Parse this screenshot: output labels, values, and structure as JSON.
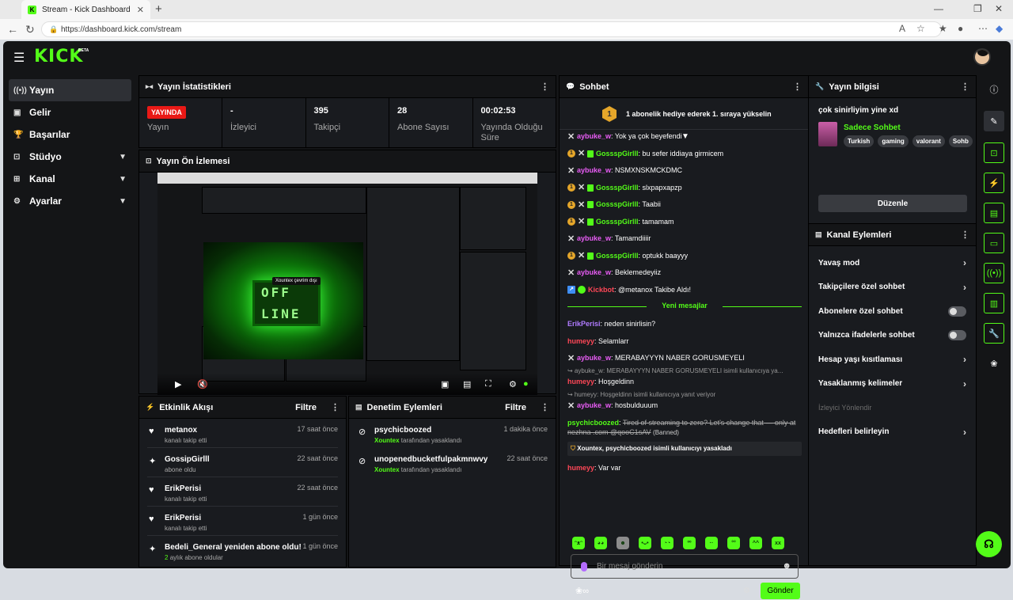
{
  "browser": {
    "tab_title": "Stream - Kick Dashboard",
    "url": "https://dashboard.kick.com/stream"
  },
  "app": {
    "logo": "KICK",
    "beta": "BETA"
  },
  "sidebar": {
    "items": [
      {
        "label": "Yayın",
        "icon": "broadcast-icon",
        "active": true,
        "chevron": false
      },
      {
        "label": "Gelir",
        "icon": "dollar-icon",
        "active": false,
        "chevron": false
      },
      {
        "label": "Başarılar",
        "icon": "trophy-icon",
        "active": false,
        "chevron": false
      },
      {
        "label": "Stüdyo",
        "icon": "studio-icon",
        "active": false,
        "chevron": true
      },
      {
        "label": "Kanal",
        "icon": "channel-icon",
        "active": false,
        "chevron": true
      },
      {
        "label": "Ayarlar",
        "icon": "gear-icon",
        "active": false,
        "chevron": true
      }
    ]
  },
  "stats": {
    "title": "Yayın İstatistikleri",
    "items": [
      {
        "value": "YAYINDA",
        "label": "Yayın"
      },
      {
        "value": "-",
        "label": "İzleyici"
      },
      {
        "value": "395",
        "label": "Takipçi"
      },
      {
        "value": "28",
        "label": "Abone Sayısı"
      },
      {
        "value": "00:02:53",
        "label": "Yayında Olduğu Süre"
      }
    ]
  },
  "preview": {
    "title": "Yayın Ön İzlemesi",
    "offline_top": "OFF",
    "offline_bottom": "LINE",
    "offline_label": "Xountex çevrim dışı"
  },
  "activity": {
    "title": "Etkinlik Akışı",
    "filter": "Filtre",
    "rows": [
      {
        "icon": "heart-icon",
        "name": "metanox",
        "sub": "kanalı takip etti",
        "time": "17 saat önce"
      },
      {
        "icon": "sparkle-icon",
        "name": "GossipGirlll",
        "sub": "abone oldu",
        "time": "22 saat önce"
      },
      {
        "icon": "heart-icon",
        "name": "ErikPerisi",
        "sub": "kanalı takip etti",
        "time": "22 saat önce"
      },
      {
        "icon": "heart-icon",
        "name": "ErikPerisi",
        "sub": "kanalı takip etti",
        "time": "1 gün önce"
      },
      {
        "icon": "sparkle-icon",
        "name": "Bedeli_General yeniden abone oldu!",
        "sub_green": "2",
        "sub": "aylık abone oldular",
        "time": "1 gün önce"
      }
    ]
  },
  "moderation": {
    "title": "Denetim Eylemleri",
    "filter": "Filtre",
    "rows": [
      {
        "name": "psychicboozed",
        "mod": "Xountex",
        "action": "tarafından yasaklandı",
        "time": "1 dakika önce"
      },
      {
        "name": "unopenedbucketfulpakmnwvy",
        "mod": "Xountex",
        "action": "tarafından yasaklandı",
        "time": "22 saat önce"
      }
    ]
  },
  "chat": {
    "title": "Sohbet",
    "pinned_badge": "1",
    "pinned": "1 abonelik hediye ederek 1. sıraya yükselin",
    "new_messages": "Yeni mesajlar",
    "messages_before": [
      {
        "badges": [
          "x"
        ],
        "user": "aybuke_w",
        "color": "pk",
        "text": "Yok ya çok beyefendi"
      },
      {
        "badges": [
          "sub",
          "x",
          "gr"
        ],
        "user": "GossspGirlll",
        "color": "gn",
        "text": "bu sefer iddiaya girmicem"
      },
      {
        "badges": [
          "x"
        ],
        "user": "aybuke_w",
        "color": "pk",
        "text": "NSMXNSKMCKDMC"
      },
      {
        "badges": [
          "sub",
          "x",
          "gr"
        ],
        "user": "GossspGirlll",
        "color": "gn",
        "text": "slxpapxapzp"
      },
      {
        "badges": [
          "sub",
          "x",
          "gr"
        ],
        "user": "GossspGirlll",
        "color": "gn",
        "text": "Taabii"
      },
      {
        "badges": [
          "sub",
          "x",
          "gr"
        ],
        "user": "GossspGirlll",
        "color": "gn",
        "text": "tamamam"
      },
      {
        "badges": [
          "x"
        ],
        "user": "aybuke_w",
        "color": "pk",
        "text": "Tamamdiiiir"
      },
      {
        "badges": [
          "sub",
          "x",
          "gr"
        ],
        "user": "GossspGirlll",
        "color": "gn",
        "text": "optukk baayyy"
      },
      {
        "badges": [
          "x"
        ],
        "user": "aybuke_w",
        "color": "pk",
        "text": "Beklemedeyiiz"
      },
      {
        "badges": [
          "kick",
          "flower"
        ],
        "user": "Kickbot",
        "color": "rd",
        "text": "@metanox Takibe Aldı!"
      }
    ],
    "msg_erik": {
      "user": "ErikPerisi",
      "text": "neden sinirlisin?"
    },
    "msg_h1": {
      "user": "humeyy",
      "text": "Selamlarr"
    },
    "msg_a1": {
      "user": "aybuke_w",
      "text": "MERABAYYYN NABER GORUSMEYELI"
    },
    "reply1": "↪ aybuke_w: MERABAYYYN NABER GORUSMEYELI isimli kullanıcıya ya...",
    "msg_h2": {
      "user": "humeyy",
      "text": "Hoşgeldinn"
    },
    "reply2": "↪ humeyy: Hoşgeldinn isimli kullanıcıya yanıt veriyor",
    "msg_a2": {
      "user": "aybuke_w",
      "text": "hosbulduuum"
    },
    "banned_user": "psychicboozed",
    "banned_text": "Tired of streaming to zero? Let's change that — only at nezhna .com @qooC1sAV",
    "banned_tag": "(Banned)",
    "mod_notice": "Xountex, psychicboozed isimli kullanıcıyı yasakladı",
    "msg_h3": {
      "user": "humeyy",
      "text": "Var var"
    },
    "input_placeholder": "Bir mesaj gönderin",
    "send": "Gönder"
  },
  "info": {
    "title": "Yayın bilgisi",
    "stream_title": "çok sinirliyim yine xd",
    "category": "Sadece Sohbet",
    "tags": [
      "Turkish",
      "gaming",
      "valorant",
      "Sohb"
    ],
    "edit": "Düzenle"
  },
  "actions": {
    "title": "Kanal Eylemleri",
    "items": [
      {
        "label": "Yavaş mod",
        "kind": "chevron"
      },
      {
        "label": "Takipçilere özel sohbet",
        "kind": "chevron"
      },
      {
        "label": "Abonelere özel sohbet",
        "kind": "toggle"
      },
      {
        "label": "Yalnızca ifadelerle sohbet",
        "kind": "toggle"
      },
      {
        "label": "Hesap yaşı kısıtlaması",
        "kind": "chevron"
      },
      {
        "label": "Yasaklanmış kelimeler",
        "kind": "chevron"
      },
      {
        "label": "İzleyici Yönlendir",
        "kind": "dim"
      },
      {
        "label": "Hedefleri belirleyin",
        "kind": "chevron"
      }
    ]
  },
  "colors": {
    "accent": "#53fc18",
    "live": "#e91916",
    "bg": "#141517",
    "panel": "#191b1f"
  }
}
